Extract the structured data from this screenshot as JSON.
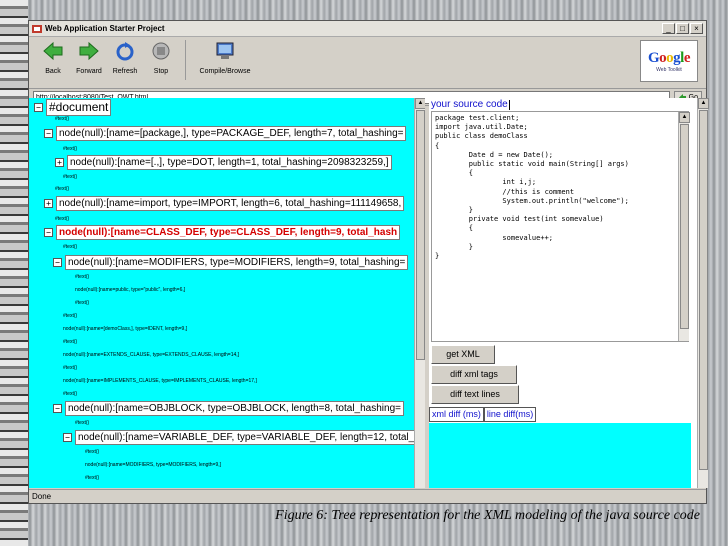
{
  "window": {
    "title": "Web Application Starter Project",
    "controls": [
      "_",
      "□",
      "×"
    ]
  },
  "toolbar": {
    "back": "Back",
    "forward": "Forward",
    "refresh": "Refresh",
    "stop": "Stop",
    "compile": "Compile/Browse"
  },
  "google": {
    "logo": "Google",
    "sub": "Web Toolkit"
  },
  "address": {
    "url": "http://localhost:8080/Test_OWT.html",
    "go": "Go"
  },
  "tree": {
    "root": "#document",
    "nodes": [
      {
        "text": "#text()"
      },
      {
        "text": "node(null):[name=[package,], type=PACKAGE_DEF, length=7, total_hashing="
      },
      {
        "text": "#text()"
      },
      {
        "text": "node(null):[name=[.,], type=DOT, length=1, total_hashing=2098323259,]"
      },
      {
        "text": "#text()"
      },
      {
        "text": "#text()"
      },
      {
        "text": "node(null):[name=import, type=IMPORT, length=6, total_hashing=111149658,"
      },
      {
        "text": "#text()"
      },
      {
        "text": "node(null):[name=CLASS_DEF, type=CLASS_DEF, length=9, total_hash"
      },
      {
        "text": "#text()"
      },
      {
        "text": "node(null):[name=MODIFIERS, type=MODIFIERS, length=9, total_hashing="
      },
      {
        "text": "#text()"
      },
      {
        "text": "node(null):[name=public, type=\"public\", length=6,]"
      },
      {
        "text": "#text()"
      },
      {
        "text": "#text()"
      },
      {
        "text": "node(null):[name=[demoClass,], type=IDENT, length=9,]"
      },
      {
        "text": "#text()"
      },
      {
        "text": "node(null):[name=EXTENDS_CLAUSE, type=EXTENDS_CLAUSE, length=14,]"
      },
      {
        "text": "#text()"
      },
      {
        "text": "node(null):[name=IMPLEMENTS_CLAUSE, type=IMPLEMENTS_CLAUSE, length=17,]"
      },
      {
        "text": "#text()"
      },
      {
        "text": "node(null):[name=OBJBLOCK, type=OBJBLOCK, length=8, total_hashing="
      },
      {
        "text": "#text()"
      },
      {
        "text": "node(null):[name=VARIABLE_DEF, type=VARIABLE_DEF, length=12, total_"
      },
      {
        "text": "#text()"
      },
      {
        "text": "node(null):[name=MODIFIERS, type=MODIFIERS, length=9,]"
      },
      {
        "text": "#text()"
      }
    ]
  },
  "source": {
    "header": "your source code",
    "code": "package test.client;\nimport java.util.Date;\npublic class demoClass\n{\n        Date d = new Date();\n        public static void main(String[] args)\n        {\n                int i,j;\n                //this is comment\n                System.out.println(\"welcome\");\n        }\n        private void test(int somevalue)\n        {\n                somevalue++;\n        }\n}"
  },
  "actions": {
    "get_xml": "get XML",
    "diff_xml_tags": "diff xml tags",
    "diff_text_lines": "diff text lines"
  },
  "diff_tabs": {
    "xml_diff": "xml diff (ms)",
    "line_diff": "line diff(ms)"
  },
  "status": "Done",
  "caption": "Figure 6: Tree representation for the XML modeling of the java source code"
}
